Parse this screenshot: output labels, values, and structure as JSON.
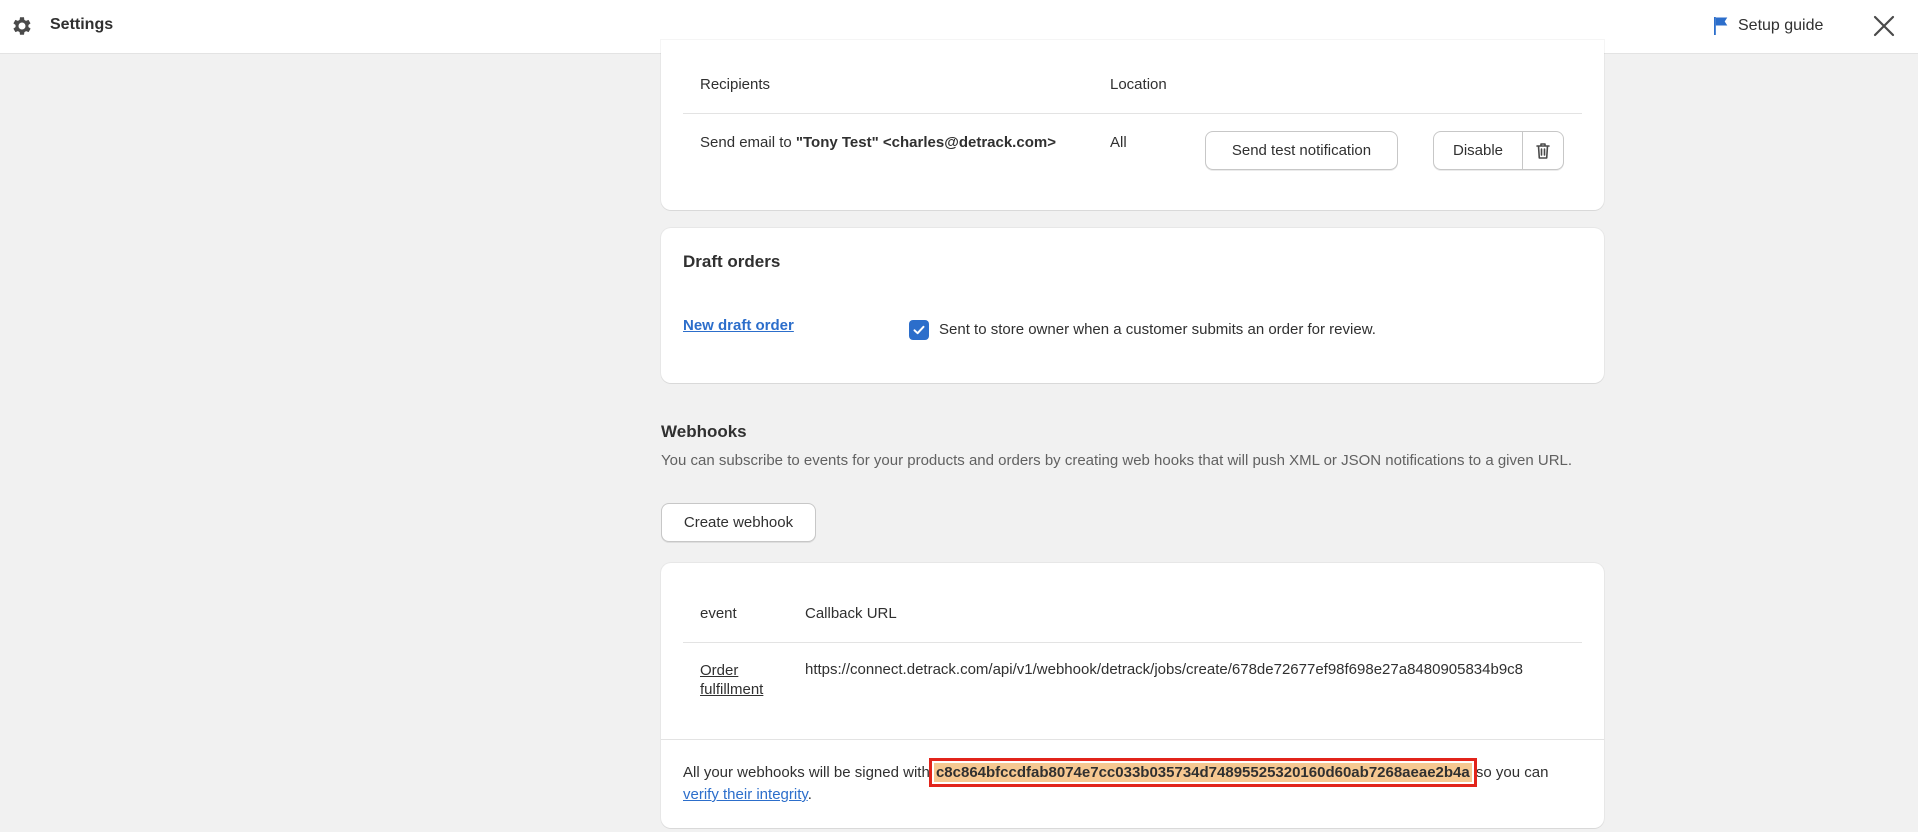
{
  "topbar": {
    "title": "Settings",
    "setup_guide_label": "Setup guide"
  },
  "email_card": {
    "col_recipients": "Recipients",
    "col_location": "Location",
    "recipient_prefix": "Send email to ",
    "recipient_value": "\"Tony Test\" <charles@detrack.com>",
    "location_value": "All",
    "send_test_label": "Send test notification",
    "disable_label": "Disable"
  },
  "draft_orders": {
    "title": "Draft orders",
    "link_label": "New draft order",
    "checkbox_checked": true,
    "description": "Sent to store owner when a customer submits an order for review."
  },
  "webhooks": {
    "title": "Webhooks",
    "description": "You can subscribe to events for your products and orders by creating web hooks that will push XML or JSON notifications to a given URL.",
    "create_label": "Create webhook",
    "col_event": "event",
    "col_callback": "Callback URL",
    "rows": [
      {
        "event_line1": "Order",
        "event_line2": "fulfillment",
        "url": "https://connect.detrack.com/api/v1/webhook/detrack/jobs/create/678de72677ef98f698e27a8480905834b9c8"
      }
    ],
    "sign_prefix": "All your webhooks will be signed with ",
    "secret": "c8c864bfccdfab8074e7cc033b035734d74895525320160d60ab7268aeae2b4a",
    "sign_middle": " so you can ",
    "verify_link": "verify their integrity",
    "sign_suffix": "."
  },
  "colors": {
    "accent": "#2c6ecb",
    "highlight_fill": "#f6c891",
    "highlight_border": "#e2241b"
  }
}
